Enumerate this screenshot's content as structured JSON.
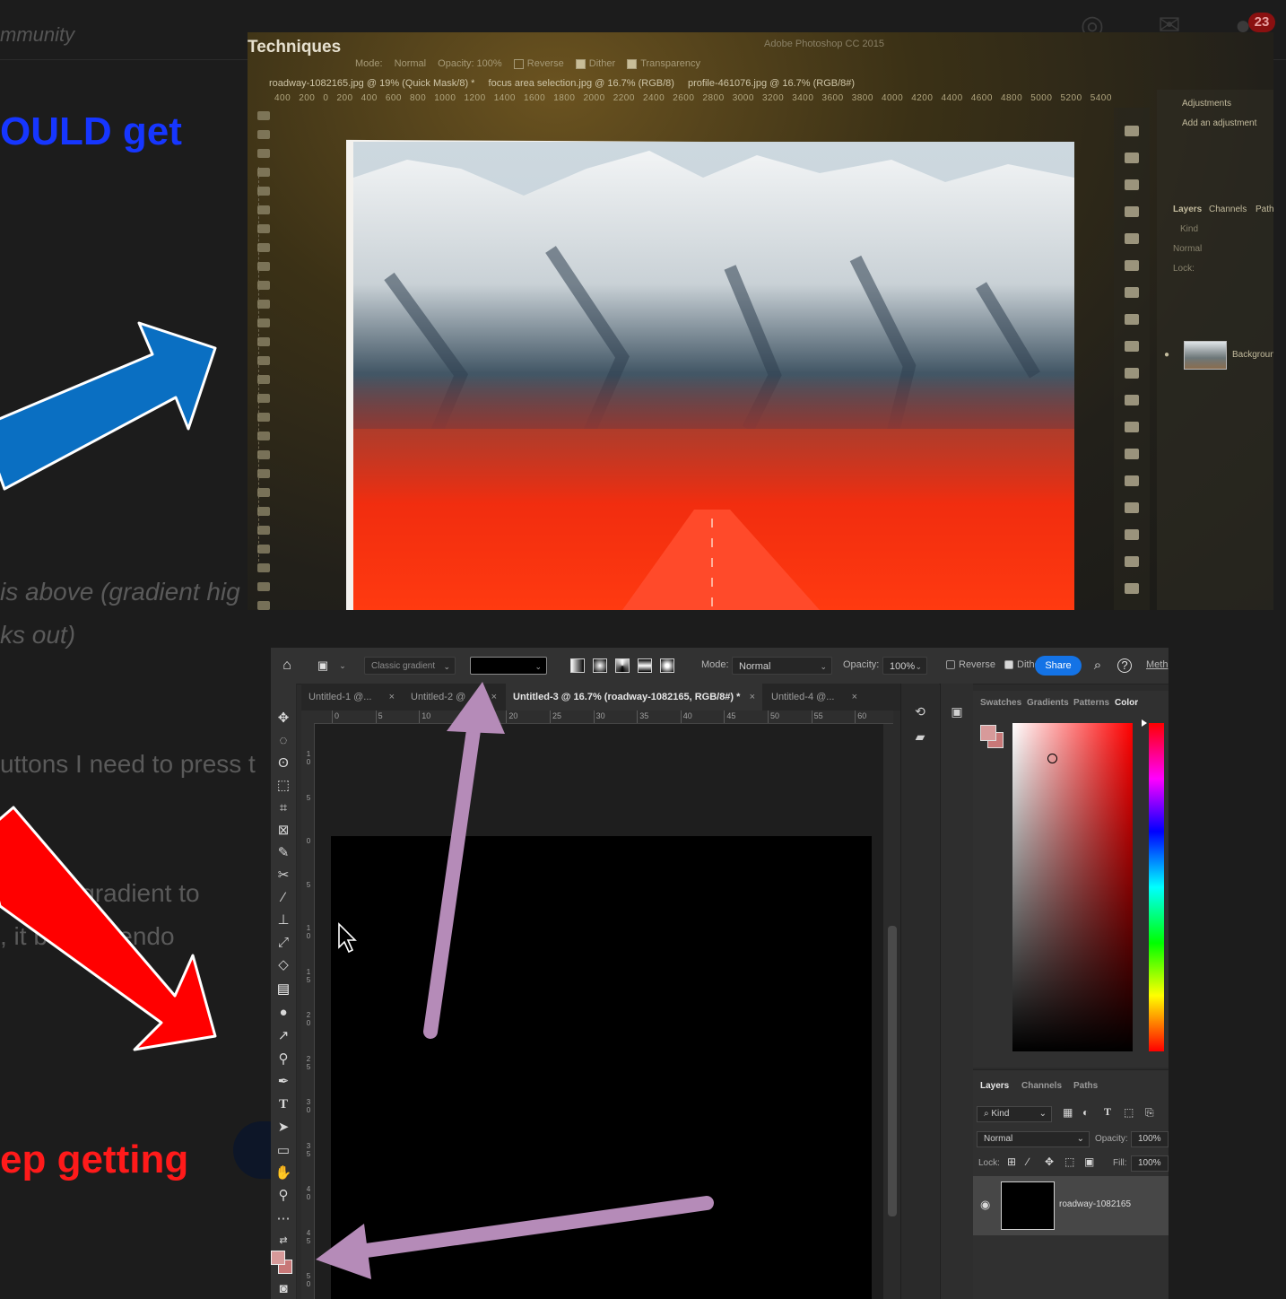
{
  "forum": {
    "breadcrumb": "mmunity",
    "notifications": "23",
    "heading_blue": "OULD get",
    "heading_red": "ep getting",
    "text_line_1": "is above (gradient hig",
    "text_line_2": "ks out)",
    "text_line_3": "uttons I need to press t",
    "text_line_4": "how to gradient to",
    "text_line_5": ", it be tremendo"
  },
  "photo": {
    "title": "Techniques",
    "app_name": "Adobe Photoshop CC 2015",
    "mode_label": "Mode:",
    "mode_value": "Normal",
    "opacity": "Opacity: 100%",
    "reverse": "Reverse",
    "dither": "Dither",
    "transparency": "Transparency",
    "tabs": [
      "roadway-1082165.jpg @ 19% (Quick Mask/8) *",
      "focus area selection.jpg @ 16.7% (RGB/8)",
      "profile-461076.jpg @ 16.7% (RGB/8#)"
    ],
    "ruler": [
      "400",
      "200",
      "0",
      "200",
      "400",
      "600",
      "800",
      "1000",
      "1200",
      "1400",
      "1600",
      "1800",
      "2000",
      "2200",
      "2400",
      "2600",
      "2800",
      "3000",
      "3200",
      "3400",
      "3600",
      "3800",
      "4000",
      "4200",
      "4400",
      "4600",
      "4800",
      "5000",
      "5200",
      "5400"
    ],
    "panel_adjustments": "Adjustments",
    "panel_add_adjustment": "Add an adjustment",
    "panel_layers": "Layers",
    "panel_channels": "Channels",
    "panel_paths": "Path",
    "panel_kind": "Kind",
    "panel_normal": "Normal",
    "panel_lock": "Lock:",
    "panel_layer_name": "Background"
  },
  "ps": {
    "gradient_preset": "Classic gradient",
    "mode_label": "Mode:",
    "mode_value": "Normal",
    "opacity_label": "Opacity:",
    "opacity_value": "100%",
    "reverse_label": "Reverse",
    "dither_label": "Dithe",
    "share_label": "Share",
    "method_label": "Meth",
    "tabs": [
      {
        "label": "Untitled-1 @..."
      },
      {
        "label": "Untitled-2 @"
      },
      {
        "label": "Untitled-3 @ 16.7% (roadway-1082165, RGB/8#) *"
      },
      {
        "label": "Untitled-4 @..."
      }
    ],
    "ruler_h": [
      "0",
      "5",
      "10",
      "15",
      "20",
      "25",
      "30",
      "35",
      "40",
      "45",
      "50",
      "55",
      "60"
    ],
    "ruler_v": [
      "1 0",
      "5",
      "0",
      "5",
      "1 0",
      "1 5",
      "2 0",
      "2 5",
      "3 0",
      "3 5",
      "4 0",
      "4 5",
      "5 0"
    ],
    "color_tabs": [
      "Swatches",
      "Gradients",
      "Patterns",
      "Color"
    ],
    "layers_tabs": [
      "Layers",
      "Channels",
      "Paths"
    ],
    "kind_label": "Kind",
    "blend_mode": "Normal",
    "layer_opacity_label": "Opacity:",
    "layer_opacity_value": "100%",
    "lock_label": "Lock:",
    "fill_label": "Fill:",
    "fill_value": "100%",
    "layer_name": "roadway-1082165"
  },
  "colors": {
    "arrow_blue": "#0a6fc2",
    "arrow_red": "#ff0000",
    "arrow_purple": "#b58bb8",
    "foreground_swatch": "#d79a9a",
    "background_swatch": "#c87878"
  }
}
